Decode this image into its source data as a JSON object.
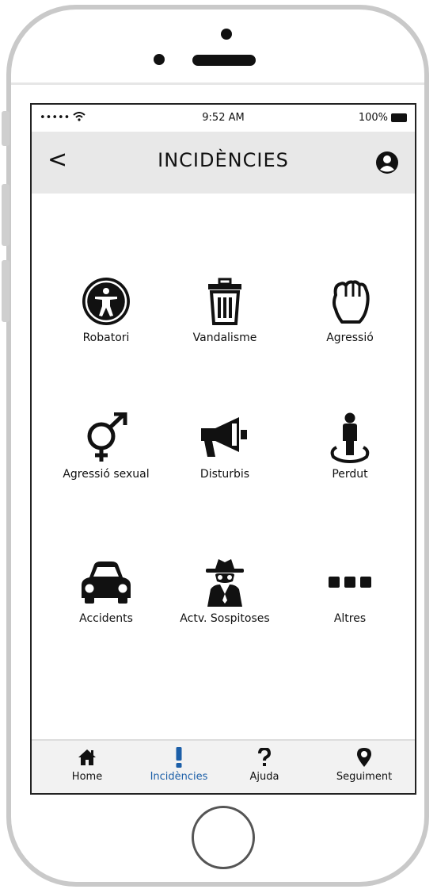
{
  "status_bar": {
    "signal": "••••• ",
    "time": "9:52 AM",
    "battery": "100%"
  },
  "header": {
    "title": "INCIDÈNCIES",
    "back": "<"
  },
  "categories": [
    {
      "label": "Robatori",
      "icon": "accessibility-icon"
    },
    {
      "label": "Vandalisme",
      "icon": "trash-icon"
    },
    {
      "label": "Agressió",
      "icon": "fist-icon"
    },
    {
      "label": "Agressió sexual",
      "icon": "gender-icon"
    },
    {
      "label": "Disturbis",
      "icon": "megaphone-icon"
    },
    {
      "label": "Perdut",
      "icon": "person-location-icon"
    },
    {
      "label": "Accidents",
      "icon": "car-icon"
    },
    {
      "label": "Actv. Sospitoses",
      "icon": "spy-icon"
    },
    {
      "label": "Altres",
      "icon": "more-icon"
    }
  ],
  "tabbar": {
    "active_color": "#1c5fa8",
    "items": [
      {
        "label": "Home",
        "icon": "home-icon"
      },
      {
        "label": "Incidències",
        "icon": "exclamation-icon"
      },
      {
        "label": "Ajuda",
        "icon": "question-icon"
      },
      {
        "label": "Seguiment",
        "icon": "map-pin-icon"
      }
    ]
  }
}
